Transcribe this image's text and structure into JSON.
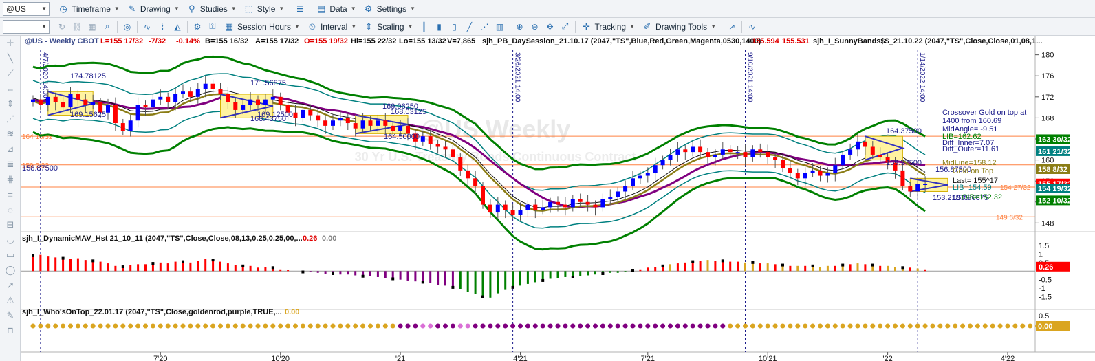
{
  "toolbar1": {
    "symbol": "@US",
    "timeframe": "Timeframe",
    "drawing": "Drawing",
    "studies": "Studies",
    "style": "Style",
    "data": "Data",
    "settings": "Settings"
  },
  "toolbar2": {
    "session_hours": "Session Hours",
    "interval": "Interval",
    "scaling": "Scaling",
    "tracking": "Tracking",
    "drawing_tools": "Drawing Tools"
  },
  "icons": {
    "timeframe": "clock-icon",
    "drawing": "pencil-icon",
    "studies": "studies-icon",
    "style": "style-icon",
    "data": "data-icon",
    "settings": "gear-icon",
    "session": "calendar-icon",
    "interval": "interval-icon",
    "scaling": "scaling-icon",
    "tracking": "crosshair-icon",
    "drawing_tools": "drawing-tools-icon"
  },
  "header": {
    "symbol": "@US - Weekly  CBOT",
    "low": "L=155 17/32",
    "chg": "-7/32",
    "pct": "-0.14%",
    "bid": "B=155 16/32",
    "ask": "A=155 17/32",
    "open": "O=155 19/32",
    "high": "Hi=155 22/32",
    "lo": "Lo=155 13/32",
    "vol": "V=7,865",
    "study1": "sjh_PB_DaySession_21.10.17 (2047,\"TS\",Blue,Red,Green,Magenta,0530,1400)",
    "val1": "155.594",
    "val2": "155.531",
    "study2": "sjh_I_SunnyBands$$_21.10.22 (2047,\"TS\",Close,Close,01,08,1..."
  },
  "watermark": {
    "title": "@US Weekly",
    "subtitle": "30 Yr U.S. Treasury Bonds Continuous Contract"
  },
  "sub1_label": "sjh_I_DynamicMAV_Hst 21_10_11 (2047,\"TS\",Close,Close,08,13,0.25,0.25,00,...",
  "sub1_vals": [
    "0.26",
    "0.00"
  ],
  "sub2_label": "sjh_I_Who'sOnTop_22.01.17 (2047,\"TS\",Close,goldenrod,purple,TRUE,...",
  "sub2_val": "0.00",
  "annotations": {
    "labels": [
      "174.78125",
      "169.15625",
      "171.56875",
      "169.12500",
      "168.43750",
      "169.06250",
      "168.03125",
      "164.50000",
      "164.37500",
      "159.37500",
      "156.87500",
      "153.21875",
      "153.96875",
      "158.87500",
      "164 16/32",
      "159 2/32"
    ],
    "right_text": [
      "Crossover Gold on top at",
      "1400 from 160.69",
      "MidAngle= -9.51",
      "LIB=162.62",
      "Diff_Inner=7.07",
      "Diff_Outer=11.61",
      "MidLine=158.12",
      "Gold on Top",
      "Last= 155^17",
      "LIB=154.59",
      "OIB=152.32"
    ],
    "vlines": [
      "4/7/2020 14:00",
      "3/26/2021 14:00",
      "9/10/2021 14:00",
      "1/14/2022 14:00"
    ]
  },
  "colors": {
    "up": "#0000ff",
    "down": "#ff0000",
    "band_green": "#008000",
    "band_teal": "#008080",
    "purple": "#800080",
    "gold": "#8b7d16",
    "hline": "#ff8040",
    "goldenrod": "#daa520",
    "violet": "#da70d6"
  },
  "chart_data": [
    {
      "type": "candlestick",
      "title": "@US - Weekly CBOT",
      "ylim": [
        147,
        181
      ],
      "y_ticks": [
        148,
        152,
        156,
        160,
        164,
        168,
        172,
        176,
        180
      ],
      "x_ticks": [
        "7'20",
        "10'20",
        "'21",
        "4'21",
        "7'21",
        "10'21",
        "'22",
        "4'22"
      ],
      "horizontal_levels": [
        {
          "value": 164.5,
          "label": "164 16/32"
        },
        {
          "value": 159.06,
          "label": "159 2/32"
        },
        {
          "value": 154.84,
          "label": "154 27/32"
        },
        {
          "value": 149.19,
          "label": "149 6/32"
        }
      ],
      "price_badges": [
        {
          "label": "163 30/32",
          "value": 163.94,
          "color": "#008000"
        },
        {
          "label": "161 21/32",
          "value": 161.66,
          "color": "#008080"
        },
        {
          "label": "158 8/32",
          "value": 158.25,
          "color": "#8b7d16"
        },
        {
          "label": "155 17/32",
          "value": 155.53,
          "color": "#ff0000"
        },
        {
          "label": "154 19/32",
          "value": 154.59,
          "color": "#008080"
        },
        {
          "label": "152 10/32",
          "value": 152.31,
          "color": "#008000"
        }
      ],
      "closes": [
        171.5,
        170.5,
        172.0,
        171.0,
        170.0,
        172.5,
        171.5,
        170.5,
        171.0,
        169.0,
        170.5,
        167.0,
        165.5,
        167.5,
        170.5,
        170.0,
        171.5,
        172.0,
        171.0,
        172.5,
        173.0,
        172.0,
        173.5,
        174.5,
        173.5,
        172.5,
        171.0,
        169.5,
        170.5,
        171.5,
        170.5,
        171.5,
        172.0,
        170.5,
        169.0,
        168.0,
        169.5,
        168.5,
        167.5,
        166.5,
        167.5,
        168.0,
        167.0,
        166.0,
        167.5,
        166.5,
        167.5,
        166.5,
        165.5,
        166.5,
        165.0,
        163.5,
        164.5,
        163.0,
        162.5,
        162.0,
        160.5,
        158.0,
        156.5,
        155.0,
        151.5,
        150.0,
        151.5,
        150.5,
        149.5,
        150.5,
        151.5,
        150.5,
        151.0,
        152.0,
        151.5,
        151.0,
        152.5,
        152.0,
        151.5,
        151.0,
        152.5,
        153.0,
        154.0,
        155.0,
        156.5,
        157.0,
        157.5,
        159.0,
        160.0,
        161.0,
        162.0,
        161.5,
        162.5,
        161.5,
        160.5,
        161.0,
        162.0,
        161.5,
        161.5,
        160.5,
        162.0,
        161.5,
        160.5,
        160.0,
        158.5,
        157.5,
        156.5,
        157.5,
        158.0,
        157.0,
        157.5,
        159.0,
        161.0,
        162.0,
        163.5,
        162.5,
        161.0,
        160.5,
        159.5,
        158.0,
        155.0,
        154.0,
        155.5,
        155.5
      ]
    },
    {
      "type": "bar",
      "title": "sjh_I_DynamicMAV_Hst",
      "ylim": [
        -2.0,
        1.7
      ],
      "y_ticks": [
        1.5,
        1,
        0.5,
        -0.5,
        -1,
        -1.5
      ],
      "values": [
        0.9,
        0.95,
        0.85,
        0.8,
        0.75,
        0.7,
        0.75,
        0.65,
        0.6,
        0.55,
        0.45,
        0.3,
        0.25,
        0.35,
        0.4,
        0.4,
        0.45,
        0.5,
        0.45,
        0.55,
        0.55,
        0.5,
        0.6,
        0.7,
        0.65,
        0.55,
        0.45,
        0.35,
        0.3,
        0.3,
        0.2,
        0.25,
        0.2,
        0.1,
        0.05,
        0.0,
        -0.05,
        -0.05,
        -0.1,
        -0.15,
        -0.15,
        -0.2,
        -0.2,
        -0.25,
        -0.3,
        -0.3,
        -0.35,
        -0.4,
        -0.45,
        -0.5,
        -0.55,
        -0.6,
        -0.65,
        -0.7,
        -0.8,
        -0.85,
        -0.95,
        -1.05,
        -1.2,
        -1.35,
        -1.5,
        -1.55,
        -1.3,
        -1.1,
        -0.95,
        -0.85,
        -0.75,
        -0.65,
        -0.55,
        -0.45,
        -0.4,
        -0.35,
        -0.35,
        -0.3,
        -0.25,
        -0.2,
        -0.15,
        -0.1,
        -0.1,
        -0.05,
        0.05,
        0.1,
        0.2,
        0.25,
        0.3,
        0.4,
        0.45,
        0.5,
        0.55,
        0.6,
        0.65,
        0.6,
        0.6,
        0.55,
        0.55,
        0.5,
        0.5,
        0.45,
        0.45,
        0.4,
        0.35,
        0.3,
        0.3,
        0.3,
        0.3,
        0.25,
        0.3,
        0.3,
        0.35,
        0.4,
        0.45,
        0.4,
        0.35,
        0.3,
        0.3,
        0.25,
        0.2,
        0.2,
        0.15,
        0.1
      ],
      "marker_every": 4
    },
    {
      "type": "dots",
      "title": "sjh_I_Who'sOnTop",
      "ylim": [
        -0.8,
        0.8
      ],
      "y_ticks": [
        0.5
      ],
      "states": "GGGGGGGGGGGGGGGGGGGGGGGGGGGGGGGGGGGGGGGGGGGGGGGGGPPPVVPPPVVPPPPPPPPPPPPPPPPPPPPPPPPPPPPPPPPPPGGGGGGGGGGGGGGGGGGGGGGGGGGGGGGGGGGGGGGGGGG"
    }
  ]
}
